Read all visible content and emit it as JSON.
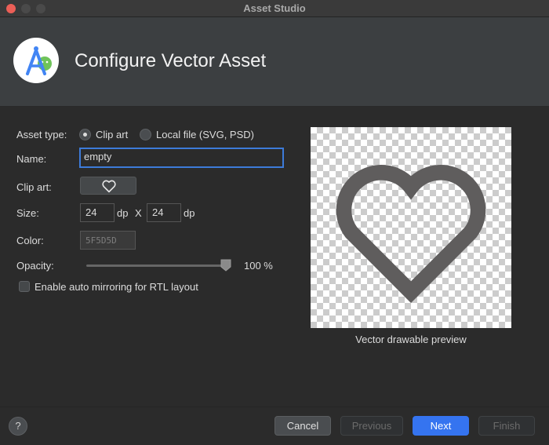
{
  "window": {
    "title": "Asset Studio"
  },
  "banner": {
    "title": "Configure Vector Asset"
  },
  "form": {
    "asset_type_label": "Asset type:",
    "asset_type_options": [
      "Clip art",
      "Local file (SVG, PSD)"
    ],
    "asset_type_selected": "Clip art",
    "name_label": "Name:",
    "name_value": "empty",
    "clipart_label": "Clip art:",
    "clipart_icon": "heart-outline-icon",
    "size_label": "Size:",
    "width_value": "24",
    "height_value": "24",
    "unit": "dp",
    "times": "X",
    "color_label": "Color:",
    "color_value": "5F5D5D",
    "opacity_label": "Opacity:",
    "opacity_value": "100 %",
    "opacity_fraction": 1.0,
    "mirroring_label": "Enable auto mirroring for RTL layout",
    "mirroring_checked": false
  },
  "preview": {
    "caption": "Vector drawable preview",
    "icon": "heart-outline-icon",
    "icon_color": "#5F5D5D"
  },
  "footer": {
    "help_label": "?",
    "cancel_label": "Cancel",
    "previous_label": "Previous",
    "next_label": "Next",
    "finish_label": "Finish"
  },
  "colors": {
    "accent": "#3574f0",
    "background": "#2b2b2b",
    "banner": "#3c3f41",
    "close": "#ec5f57"
  }
}
